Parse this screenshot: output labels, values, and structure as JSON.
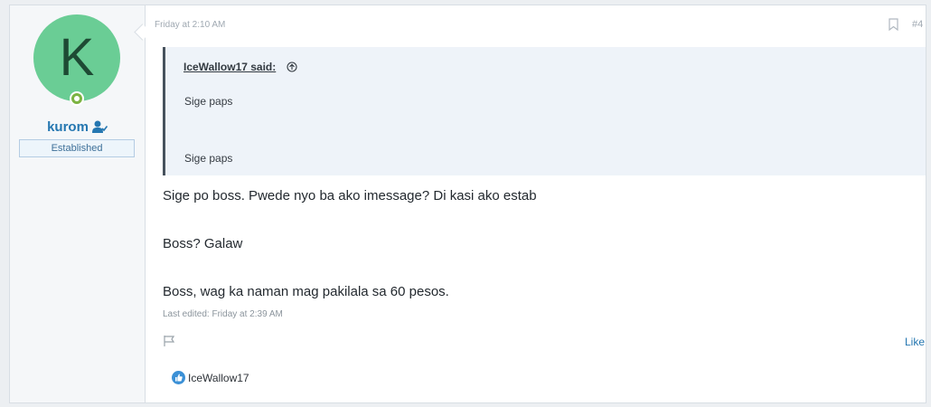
{
  "user": {
    "avatar_letter": "K",
    "username": "kurom",
    "title": "Established",
    "icons": {
      "online": "online-status-icon",
      "verified": "user-check-icon"
    },
    "avatar_color": "#6acd95"
  },
  "post": {
    "date": "Friday at 2:10 AM",
    "number": "#4",
    "bookmark_icon": "bookmark-icon",
    "quote": {
      "attribution": "IceWallow17 said:",
      "lines": [
        "Sige paps",
        "Sige paps"
      ],
      "icon": "arrow-up-circle-icon"
    },
    "body": [
      "Sige po boss. Pwede nyo ba ako imessage? Di kasi ako estab",
      "Boss? Galaw",
      "Boss, wag ka naman mag pakilala sa 60 pesos."
    ],
    "last_edited": "Last edited: Friday at 2:39 AM",
    "actions": {
      "report_icon": "flag-icon",
      "like_label": "Like"
    },
    "reactions": {
      "icon": "like-icon",
      "names": "IceWallow17"
    }
  },
  "colors": {
    "accent": "#2577b1",
    "quote_bg": "#eef3f9",
    "quote_border": "#47525d",
    "online": "#7cb342"
  }
}
